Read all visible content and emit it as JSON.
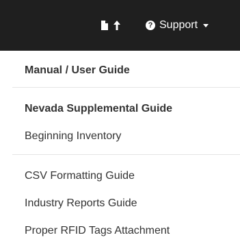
{
  "navbar": {
    "support_label": "Support",
    "help_icon_glyph": "?",
    "icons": [
      "file-icon",
      "up-arrow-icon",
      "help-icon",
      "caret-down-icon"
    ]
  },
  "dropdown": {
    "items": [
      {
        "label": "Manual / User Guide",
        "bold": true
      },
      {
        "label": "Nevada Supplemental Guide",
        "bold": true
      },
      {
        "label": "Beginning Inventory",
        "bold": false
      },
      {
        "label": "CSV Formatting Guide",
        "bold": false
      },
      {
        "label": "Industry Reports Guide",
        "bold": false
      },
      {
        "label": "Proper RFID Tags Attachment",
        "bold": false
      }
    ]
  },
  "colors": {
    "navbar_bg": "#1f1f1f",
    "text": "#333333",
    "divider": "#e5e5e5"
  }
}
